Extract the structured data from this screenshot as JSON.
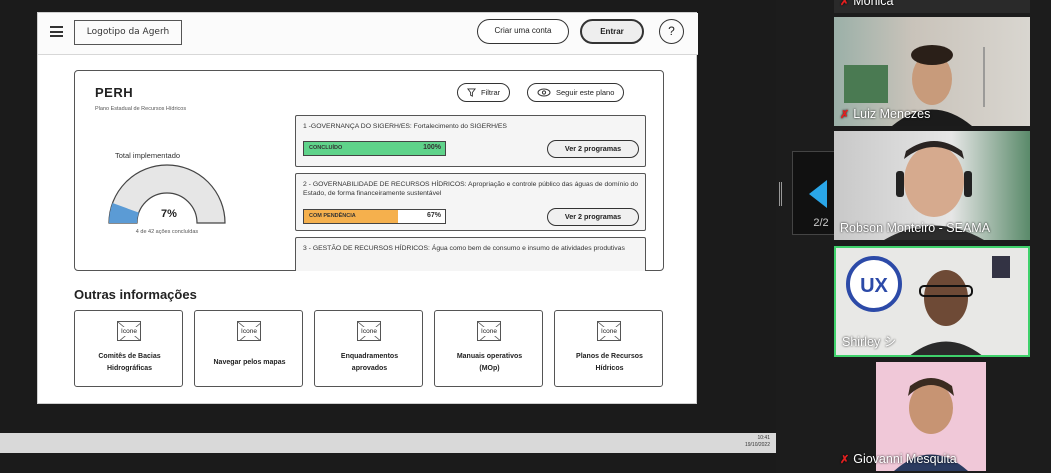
{
  "header": {
    "logo": "Logotipo da Agerh",
    "create_account": "Criar uma conta",
    "enter": "Entrar",
    "help": "?"
  },
  "plan": {
    "title": "PERH",
    "subtitle": "Plano Estadual de Recursos Hídricos",
    "filter": "Filtrar",
    "follow": "Seguir este plano",
    "total_label": "Total implementado",
    "percent": "7%",
    "percent_value": 7,
    "count": "4 de 42 ações concluídas"
  },
  "programs": [
    {
      "text": "1 -GOVERNANÇA DO SIGERH/ES: Fortalecimento do SIGERH/ES",
      "status": "CONCLUÍDO",
      "percent": "100%",
      "progress": 100,
      "color": "#5fd38a",
      "button": "Ver 2 programas"
    },
    {
      "text": "2 - GOVERNABILIDADE DE RECURSOS HÍDRICOS: Apropriação e controle público das águas de domínio do Estado, de forma financeiramente sustentável",
      "status": "COM PENDÊNCIA",
      "percent": "67%",
      "progress": 67,
      "color": "#f5b04d",
      "button": "Ver 2 programas"
    },
    {
      "text": "3 - GESTÃO DE RECURSOS HÍDRICOS: Água como bem de consumo e insumo de atividades produtivas"
    }
  ],
  "other": {
    "title": "Outras informações",
    "icon_label": "Icone",
    "tiles": [
      {
        "line1": "Comitês de Bacias",
        "line2": "Hidrográficas"
      },
      {
        "line1": "Navegar pelos mapas",
        "line2": ""
      },
      {
        "line1": "Enquadramentos",
        "line2": "aprovados"
      },
      {
        "line1": "Manuais operativos",
        "line2": "(MOp)"
      },
      {
        "line1": "Planos de Recursos",
        "line2": "Hídricos"
      }
    ]
  },
  "taskbar": {
    "time": "10:41",
    "date": "19/10/2022"
  },
  "share_nav": {
    "counter": "2/2"
  },
  "participants": [
    {
      "name": "Luiz Menezes",
      "muted": true
    },
    {
      "name": "Robson Monteiro - SEAMA",
      "muted": false
    },
    {
      "name": "Shirley シ",
      "muted": false
    },
    {
      "name": "Giovanni Mesquita",
      "muted": true
    }
  ],
  "participant_top_partial": "Monica",
  "colors": {
    "concluido": "#5fd38a",
    "pendencia": "#f5b04d",
    "gauge_fill": "#5b9bd5",
    "gauge_bg": "#e6e6e6",
    "active_speaker": "#3fd16b",
    "nav_arrow": "#2aa6e8"
  }
}
